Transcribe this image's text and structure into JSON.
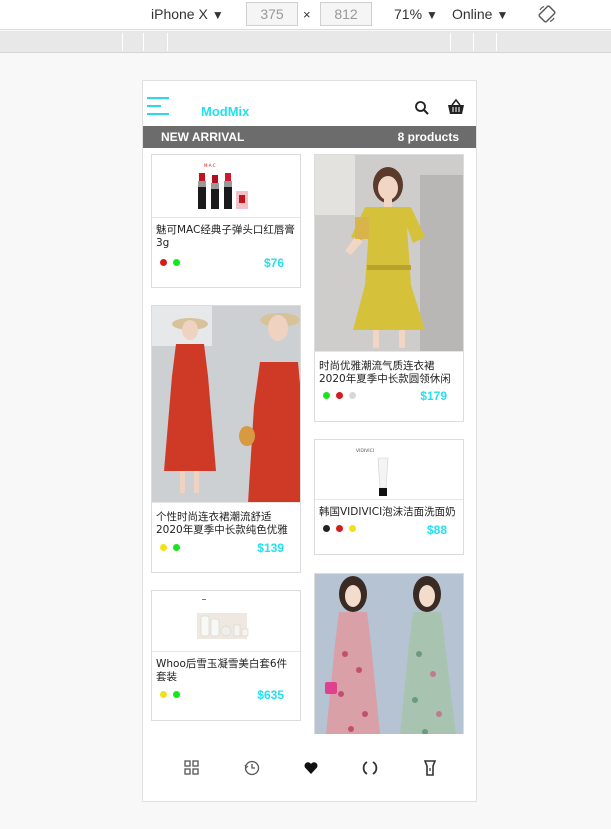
{
  "devtools": {
    "device": "iPhone X",
    "width": "375",
    "height": "812",
    "zoom": "71%",
    "network": "Online",
    "times": "×"
  },
  "header": {
    "brand": "ModMix"
  },
  "banner": {
    "left": "NEW ARRIVAL",
    "right": "8 products"
  },
  "products": [
    {
      "title": "魅可MAC经典子弹头口红唇膏3g",
      "price": "$76",
      "colors": [
        "#d41c1c",
        "#19e619"
      ]
    },
    {
      "title": "时尚优雅潮流气质连衣裙2020年夏季中长款圆领休闲",
      "price": "$179",
      "colors": [
        "#19e619",
        "#d41c1c",
        "#d8d8d8"
      ]
    },
    {
      "title": "个性时尚连衣裙潮流舒适2020年夏季中长款纯色优雅",
      "price": "$139",
      "colors": [
        "#f2e01c",
        "#19e619"
      ]
    },
    {
      "title": "韩国VIDIVICI泡沫洁面洗面奶",
      "price": "$88",
      "colors": [
        "#222222",
        "#d41c1c",
        "#f2e01c"
      ]
    },
    {
      "title": "Whoo后雪玉凝雪美白套6件套装",
      "price": "$635",
      "colors": [
        "#f2e01c",
        "#19e619"
      ]
    }
  ],
  "product_images": {
    "lipstick_brand": "M·A·C",
    "cleanser_brand": "VIDIVICI"
  },
  "accent_color": "#22e0f0"
}
